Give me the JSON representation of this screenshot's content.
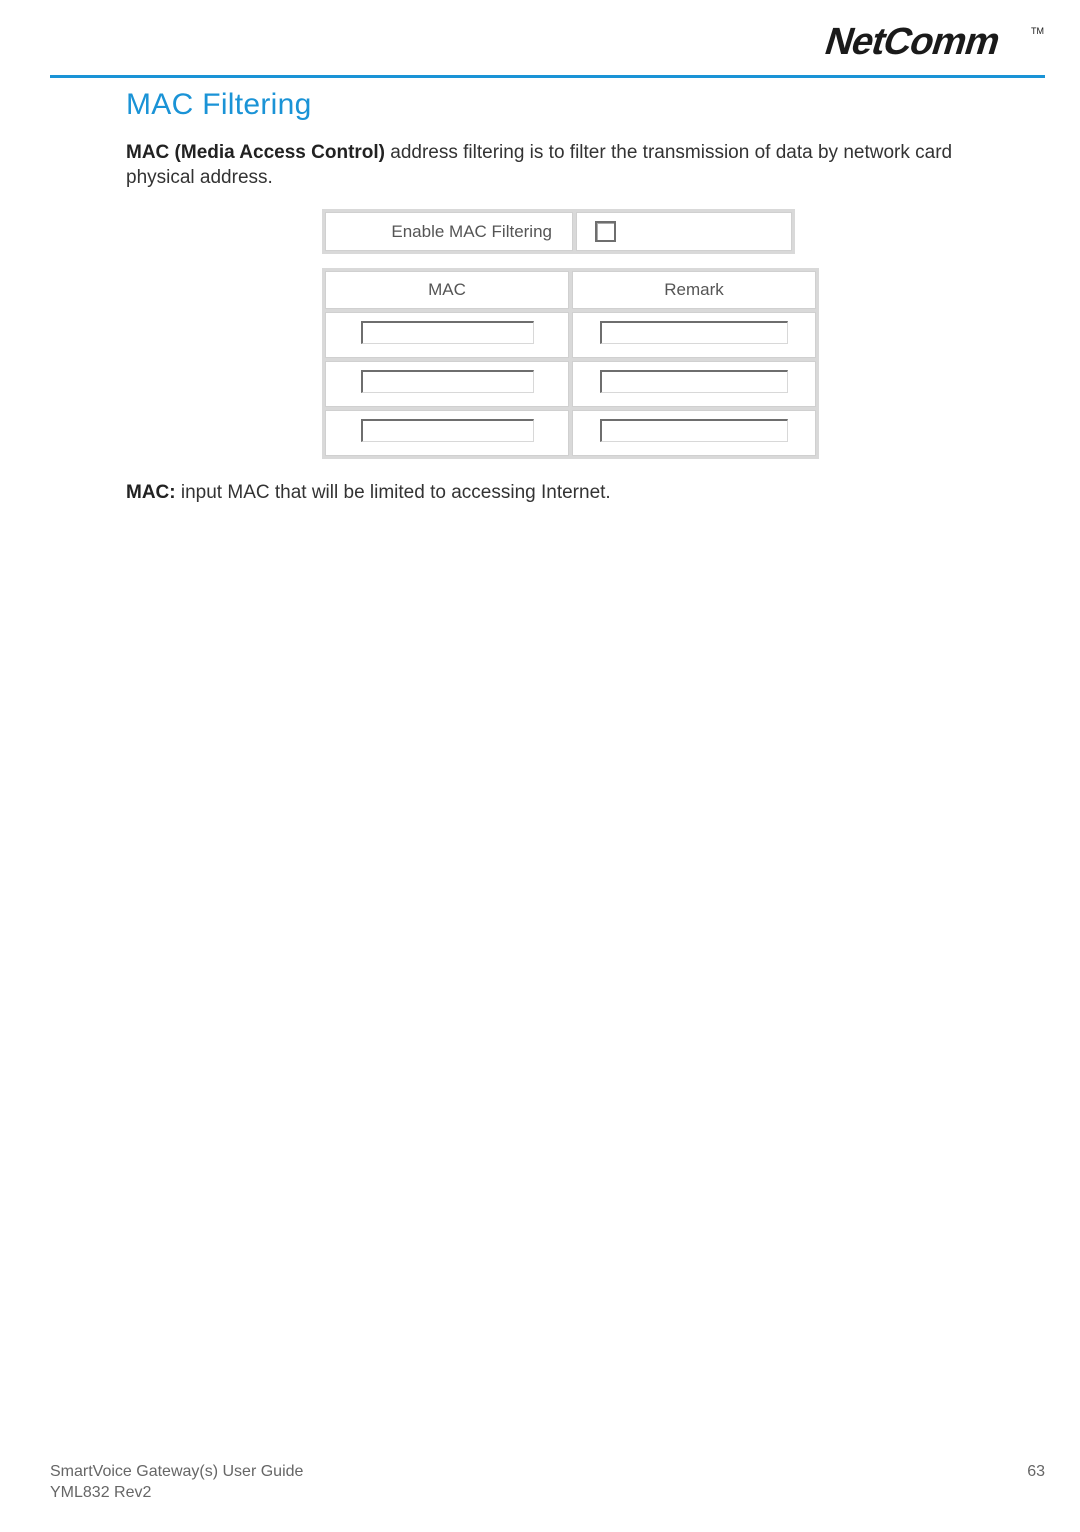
{
  "brand": {
    "name": "NetComm",
    "tm": "TM"
  },
  "section": {
    "title": "MAC Filtering"
  },
  "para1": {
    "bold": "MAC (Media Access Control)",
    "rest": " address filtering is to filter the transmission of data by network card physical address."
  },
  "ui": {
    "enable_label": "Enable MAC Filtering",
    "headers": {
      "mac": "MAC",
      "remark": "Remark"
    },
    "rows": [
      {
        "mac": "",
        "remark": ""
      },
      {
        "mac": "",
        "remark": ""
      },
      {
        "mac": "",
        "remark": ""
      }
    ]
  },
  "para2": {
    "bold": "MAC:",
    "rest": " input MAC that will be limited to accessing Internet."
  },
  "footer": {
    "guide_title": "SmartVoice Gateway(s) User Guide",
    "doc_rev": "YML832 Rev2",
    "page_number": "63"
  }
}
